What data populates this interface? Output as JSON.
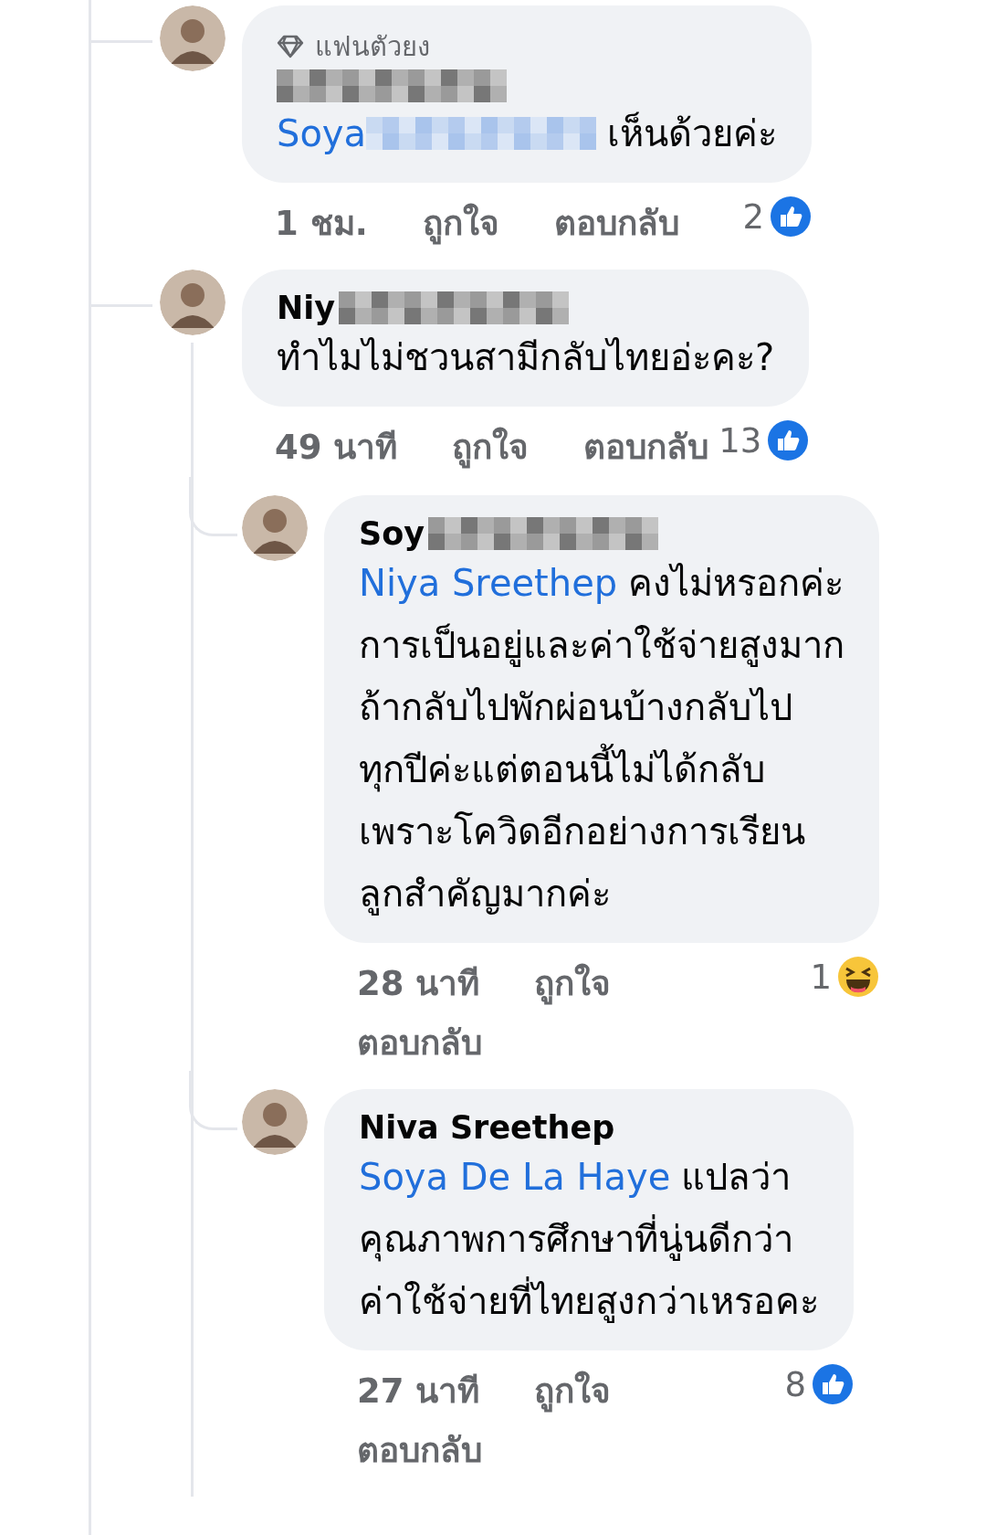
{
  "comments": [
    {
      "author_pixelated": true,
      "badge": "แฟนตัวยง",
      "mention": "Soya",
      "mention_pixelated": true,
      "lines": [
        "เห็นด้วยค่ะ"
      ],
      "time": "1 ชม.",
      "like_label": "ถูกใจ",
      "reply_label": "ตอบกลับ",
      "reaction": {
        "kind": "like",
        "count": "2"
      }
    },
    {
      "author": "Niy",
      "author_pixelated": true,
      "lines": [
        "ทำไมไม่ชวนสามีกลับไทยอ่ะคะ?"
      ],
      "time": "49 นาที",
      "like_label": "ถูกใจ",
      "reply_label": "ตอบกลับ",
      "reaction": {
        "kind": "like",
        "count": "13"
      },
      "replies": [
        {
          "author": "Soy",
          "author_pixelated": true,
          "mention": "Niya Sreethep",
          "mention_pixelated": false,
          "lines": [
            "คงไม่หรอกค่ะ",
            "การเป็นอยู่และค่าใช้จ่ายสูงมาก",
            "ถ้ากลับไปพักผ่อนบ้างกลับไป",
            "ทุกปีค่ะแต่ตอนนี้ไม่ได้กลับ",
            "เพราะโควิดอีกอย่างการเรียน",
            "ลูกสำคัญมากค่ะ"
          ],
          "time": "28 นาที",
          "like_label": "ถูกใจ",
          "reply_label": "ตอบกลับ",
          "reaction": {
            "kind": "haha",
            "count": "1"
          }
        },
        {
          "author": "Niva Sreethep",
          "author_pixelated": false,
          "mention": "Soya De La Haye",
          "mention_pixelated": false,
          "lines": [
            "แปลว่า",
            "คุณภาพการศึกษาที่นู่นดีกว่า",
            "ค่าใช้จ่ายที่ไทยสูงกว่าเหรอคะ"
          ],
          "time": "27 นาที",
          "like_label": "ถูกใจ",
          "reply_label": "ตอบกลับ",
          "reaction": {
            "kind": "like",
            "count": "8"
          }
        }
      ]
    }
  ]
}
